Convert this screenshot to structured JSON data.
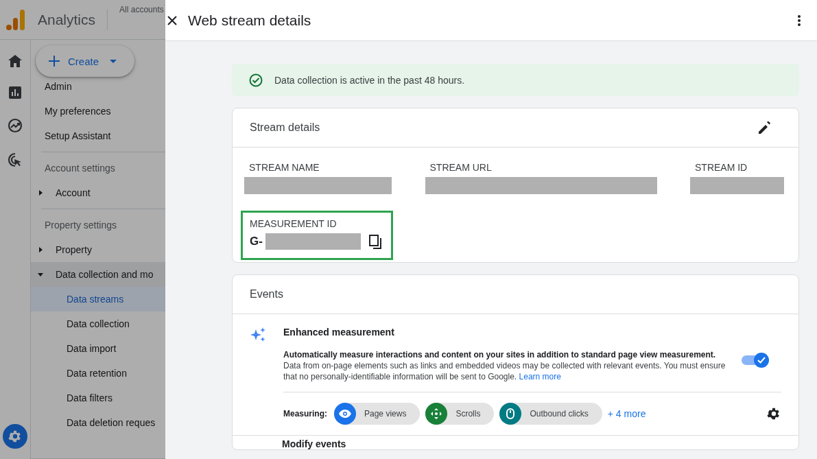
{
  "app": {
    "product": "Analytics",
    "account_picker": "All accounts"
  },
  "create_button": {
    "label": "Create"
  },
  "nav": {
    "items": [
      {
        "kind": "link",
        "label": "Admin"
      },
      {
        "kind": "link",
        "label": "My preferences"
      },
      {
        "kind": "link",
        "label": "Setup Assistant"
      },
      {
        "kind": "section",
        "label": "Account settings"
      },
      {
        "kind": "group",
        "label": "Account",
        "expanded": false
      },
      {
        "kind": "section",
        "label": "Property settings"
      },
      {
        "kind": "group",
        "label": "Property",
        "expanded": false
      },
      {
        "kind": "group",
        "label": "Data collection and mo",
        "expanded": true,
        "children": [
          {
            "label": "Data streams",
            "selected": true
          },
          {
            "label": "Data collection",
            "selected": false
          },
          {
            "label": "Data import",
            "selected": false
          },
          {
            "label": "Data retention",
            "selected": false
          },
          {
            "label": "Data filters",
            "selected": false
          },
          {
            "label": "Data deletion reques",
            "selected": false
          }
        ]
      }
    ]
  },
  "panel": {
    "title": "Web stream details",
    "alert": "Data collection is active in the past 48 hours.",
    "stream_details": {
      "title": "Stream details",
      "fields": [
        {
          "label": "STREAM NAME"
        },
        {
          "label": "STREAM URL"
        },
        {
          "label": "STREAM ID"
        }
      ],
      "measurement_id": {
        "label": "MEASUREMENT ID",
        "prefix": "G-",
        "highlighted": true
      }
    },
    "events": {
      "title": "Events",
      "enhanced": {
        "title": "Enhanced measurement",
        "lead": "Automatically measure interactions and content on your sites in addition to standard page view measurement.",
        "body": "Data from on-page elements such as links and embedded videos may be collected with relevant events. You must ensure that no personally-identifiable information will be sent to Google.",
        "link": "Learn more",
        "on": true,
        "measuring_label": "Measuring:",
        "chips": [
          {
            "kind": "eye",
            "label": "Page views",
            "color": "#1a73e8"
          },
          {
            "kind": "scroll",
            "label": "Scrolls",
            "color": "#188038"
          },
          {
            "kind": "mouse",
            "label": "Outbound clicks",
            "color": "#007b83"
          }
        ],
        "more": "+ 4 more"
      },
      "next_row": "Modify events"
    }
  }
}
